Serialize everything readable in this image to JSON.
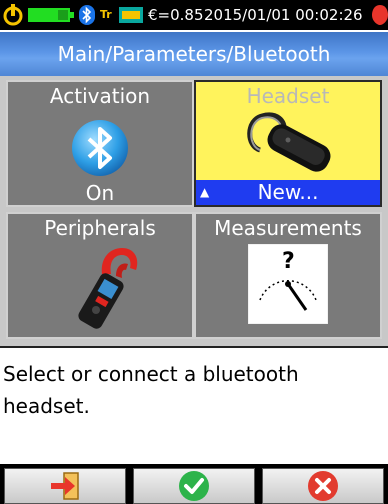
{
  "status_bar": {
    "emissivity": "€=0.85",
    "datetime": "2015/01/01 00:02:26",
    "trigger_label": "Tr",
    "icons": [
      "power-icon",
      "battery-icon",
      "bluetooth-icon",
      "trigger-icon",
      "emissivity-icon",
      "alert-icon"
    ]
  },
  "title": "Main/Parameters/Bluetooth",
  "tiles": [
    {
      "title": "Activation",
      "value": "On",
      "icon": "bluetooth-icon"
    },
    {
      "title": "Headset",
      "value": "New...",
      "icon": "headset-icon",
      "selected": true
    },
    {
      "title": "Peripherals",
      "value": "",
      "icon": "clamp-meter-icon"
    },
    {
      "title": "Measurements",
      "value": "",
      "icon": "gauge-icon"
    }
  ],
  "help_text": "Select or connect a bluetooth headset.",
  "softkeys": [
    {
      "icon": "exit-icon",
      "color": "#e8352b"
    },
    {
      "icon": "confirm-check-icon",
      "color": "#2db34a"
    },
    {
      "icon": "cancel-x-icon",
      "color": "#e23b2f"
    }
  ],
  "colors": {
    "title_bar": "#5b95e6",
    "selected_tile": "#fff35c",
    "selection_bar": "#1f3cf0",
    "tile_background": "#7a7a7a"
  }
}
